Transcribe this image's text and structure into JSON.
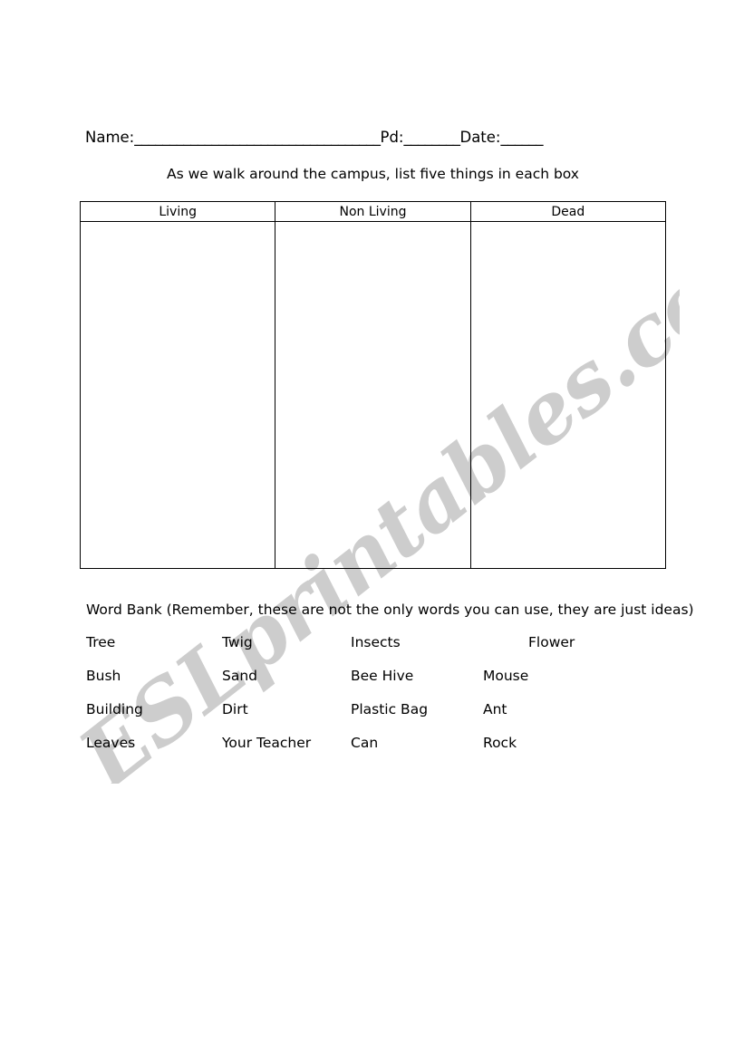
{
  "header": {
    "name_label": "Name:",
    "name_blank": "___________________________________",
    "pd_label": "Pd:",
    "pd_blank": "________",
    "date_label": "Date:",
    "date_blank": "______"
  },
  "instruction": "As we walk around the campus, list five things in each box",
  "table": {
    "columns": [
      "Living",
      "Non Living",
      "Dead"
    ],
    "rows": []
  },
  "word_bank": {
    "title": "Word Bank (Remember, these are not the only words you can use, they are just ideas)",
    "rows": [
      [
        "Tree",
        "Twig",
        "Insects",
        "Flower"
      ],
      [
        "Bush",
        "Sand",
        "Bee Hive",
        "Mouse"
      ],
      [
        "Building",
        "Dirt",
        "Plastic Bag",
        "Ant"
      ],
      [
        "Leaves",
        "Your Teacher",
        "Can",
        "Rock"
      ]
    ]
  },
  "watermark": {
    "text": "ESLprintables.com",
    "color": "#cdcdcd"
  },
  "colors": {
    "page_background": "#ffffff",
    "text": "#000000",
    "table_border": "#000000"
  }
}
